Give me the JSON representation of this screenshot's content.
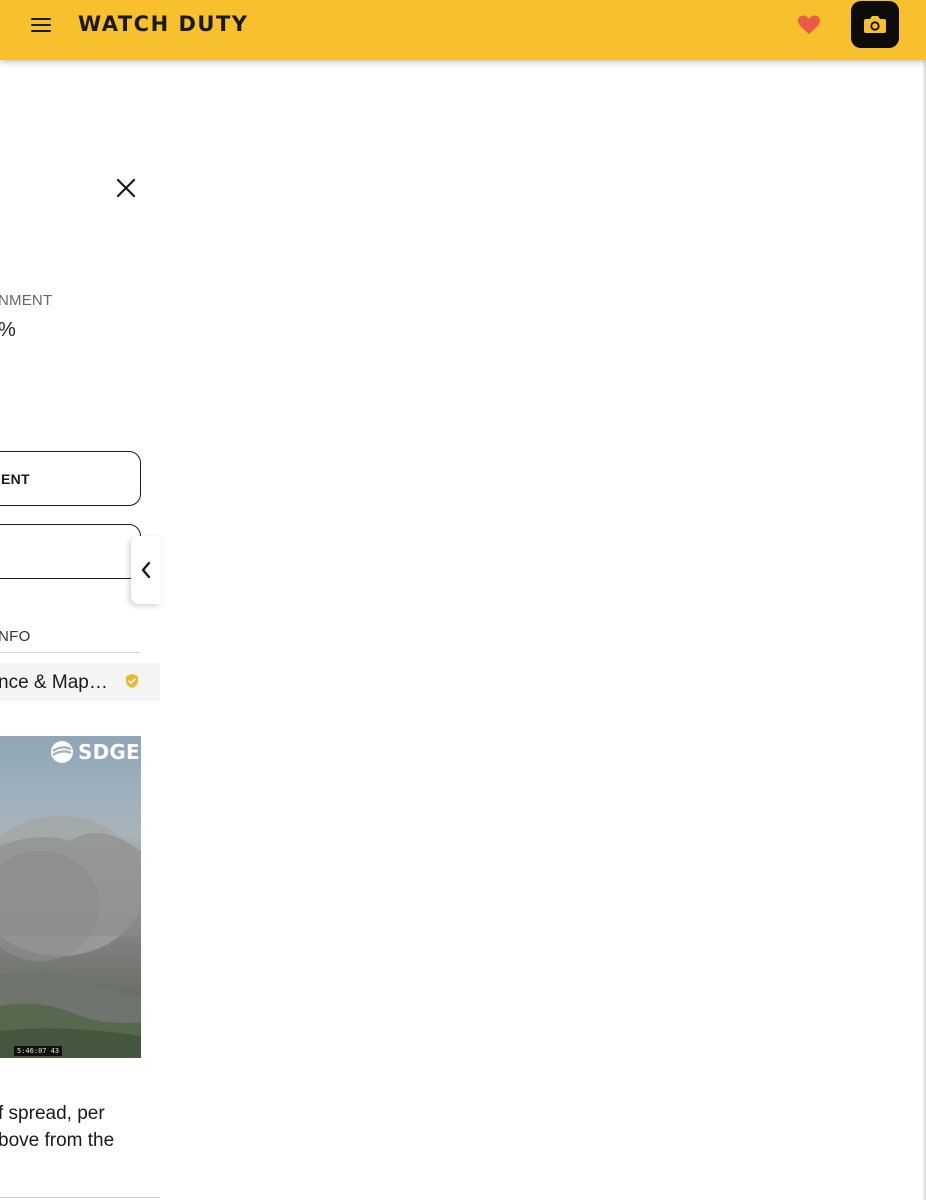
{
  "header": {
    "brand": "WATCH DUTY"
  },
  "panel": {
    "containment_label": "NMENT",
    "containment_value": "%",
    "buttons": [
      {
        "label": "ENT"
      },
      {
        "label": ""
      }
    ],
    "section_label": "NFO",
    "info_row_text": "nce & Map…",
    "camera": {
      "logo_text": "SDGE",
      "timestamp": "5:46:07 43"
    },
    "description_lines": [
      "f spread, per",
      "bove from the"
    ]
  },
  "colors": {
    "header_bg": "#f9c02d",
    "heart": "#e85b4a",
    "verified_badge": "#e8b931",
    "camera_button_bg": "#0c0c0c"
  },
  "icons": {
    "menu": "menu-icon",
    "heart": "heart-icon",
    "camera": "camera-icon",
    "close": "close-icon",
    "chevron": "chevron-left-icon",
    "verified": "verified-shield-icon"
  }
}
